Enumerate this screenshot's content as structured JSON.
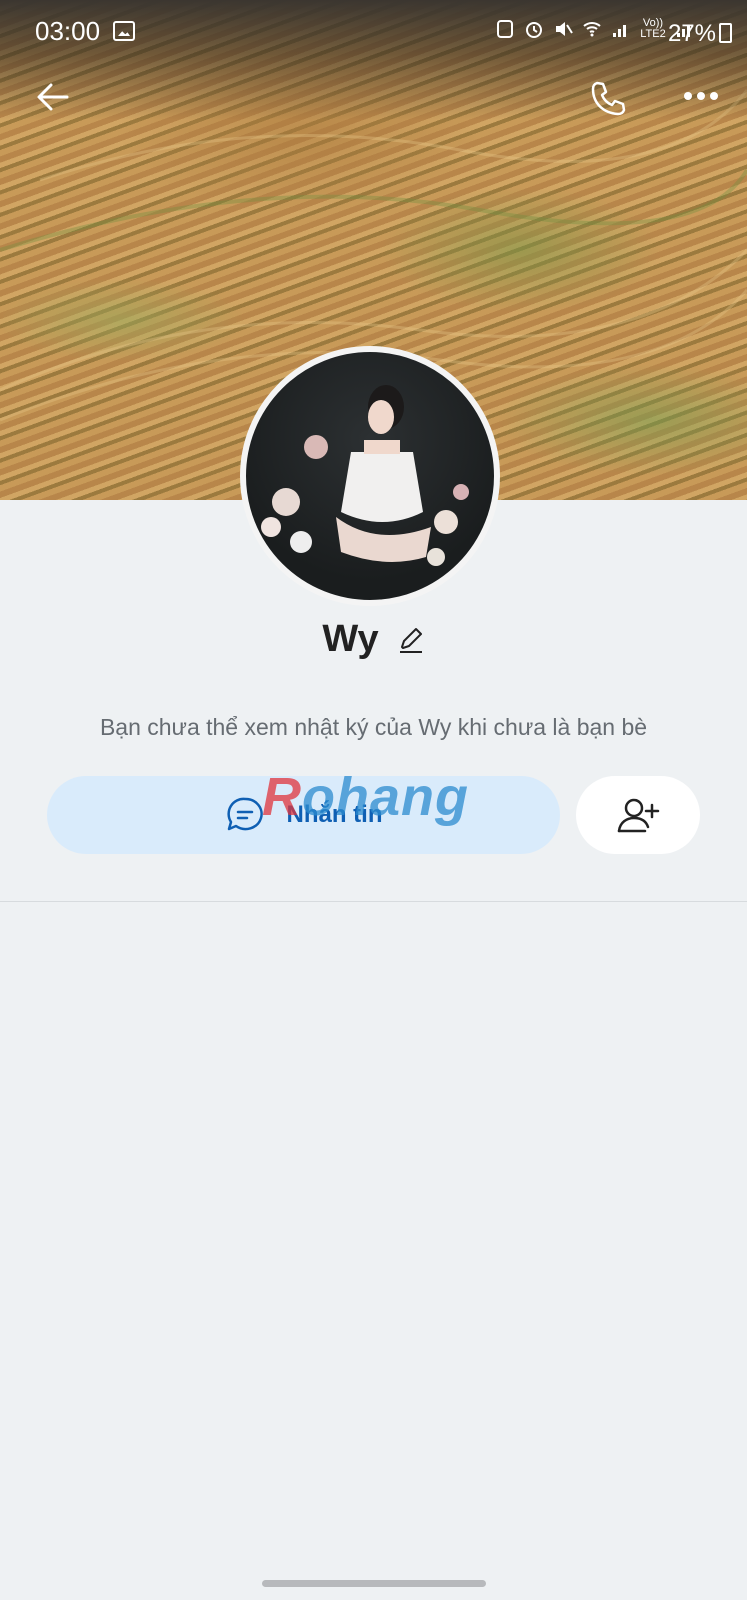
{
  "status_bar": {
    "time": "03:00",
    "network_label": "Vo)) LTE2",
    "battery": "27%"
  },
  "profile": {
    "name": "Wy",
    "privacy_notice": "Bạn chưa thể xem nhật ký của Wy khi chưa là bạn bè"
  },
  "actions": {
    "message_label": "Nhắn tin"
  },
  "watermark": {
    "first_letter": "R",
    "rest": "ohang"
  },
  "icons": {
    "back": "back-arrow-icon",
    "call": "phone-icon",
    "more": "more-dots-icon",
    "edit": "pencil-icon",
    "chat": "chat-bubble-icon",
    "add_friend": "add-friend-icon"
  },
  "colors": {
    "accent": "#0f5fb3",
    "message_button_bg": "#d9ebfb",
    "page_bg": "#eef1f3"
  }
}
